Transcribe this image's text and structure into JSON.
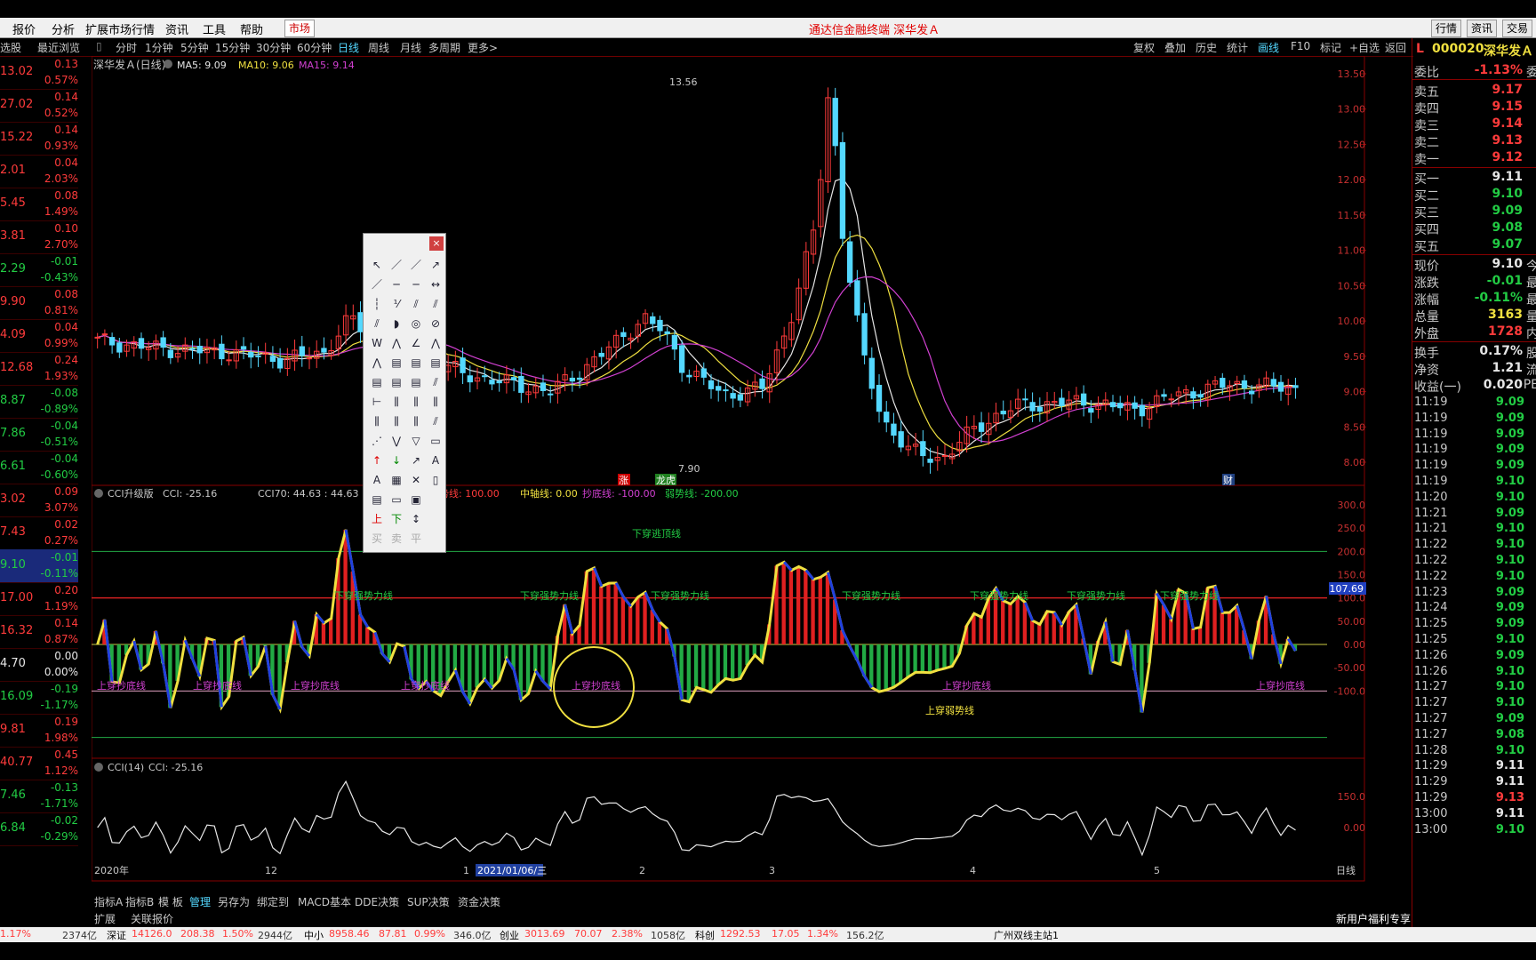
{
  "window_title": "通达信金融终端 深华发Ａ",
  "menu": [
    "报价",
    "分析",
    "扩展市场行情",
    "资讯",
    "工具",
    "帮助"
  ],
  "market_button": "市场",
  "right_buttons": [
    "行情",
    "资讯",
    "交易"
  ],
  "left_header": [
    "选股",
    "最近浏览"
  ],
  "periods": [
    "分时",
    "1分钟",
    "5分钟",
    "15分钟",
    "30分钟",
    "60分钟",
    "日线",
    "周线",
    "月线",
    "多周期",
    "更多>"
  ],
  "active_period": "日线",
  "chart_tools": [
    "复权",
    "叠加",
    "历史",
    "统计",
    "画线",
    "F10",
    "标记",
    "+自选",
    "返回"
  ],
  "stock_code": "000020",
  "stock_name": "深华发Ａ",
  "ma_legend": {
    "name": "深华发Ａ(日线)",
    "ma5": "MA5: 9.09",
    "ma10": "MA10: 9.06",
    "ma15": "MA15: 9.14"
  },
  "cci_header": {
    "name": "CCI升级版",
    "cci": "CCI: -25.16",
    "cci70": "CCI70: 44.63 : 44.63",
    "strong": "强势线: 100.00",
    "mid": "中轴线: 0.00",
    "bottom": "抄底线: -100.00",
    "weak": "弱势线: -200.00"
  },
  "cci14_header": {
    "name": "CCI(14)",
    "cci": "CCI: -25.16"
  },
  "left_list": [
    {
      "price": "13.02",
      "change": "0.13",
      "pct": "0.57%",
      "up": true
    },
    {
      "price": "27.02",
      "change": "0.14",
      "pct": "0.52%",
      "up": true
    },
    {
      "price": "15.22",
      "change": "0.14",
      "pct": "0.93%",
      "up": true
    },
    {
      "price": "2.01",
      "change": "0.04",
      "pct": "2.03%",
      "up": true
    },
    {
      "price": "5.45",
      "change": "0.08",
      "pct": "1.49%",
      "up": true
    },
    {
      "price": "3.81",
      "change": "0.10",
      "pct": "2.70%",
      "up": true
    },
    {
      "price": "2.29",
      "change": "-0.01",
      "pct": "-0.43%",
      "up": false
    },
    {
      "price": "9.90",
      "change": "0.08",
      "pct": "0.81%",
      "up": true
    },
    {
      "price": "4.09",
      "change": "0.04",
      "pct": "0.99%",
      "up": true
    },
    {
      "price": "12.68",
      "change": "0.24",
      "pct": "1.93%",
      "up": true
    },
    {
      "price": "8.87",
      "change": "-0.08",
      "pct": "-0.89%",
      "up": false
    },
    {
      "price": "7.86",
      "change": "-0.04",
      "pct": "-0.51%",
      "up": false
    },
    {
      "price": "6.61",
      "change": "-0.04",
      "pct": "-0.60%",
      "up": false
    },
    {
      "price": "3.02",
      "change": "0.09",
      "pct": "3.07%",
      "up": true
    },
    {
      "price": "7.43",
      "change": "0.02",
      "pct": "0.27%",
      "up": true
    },
    {
      "price": "9.10",
      "change": "-0.01",
      "pct": "-0.11%",
      "up": false
    },
    {
      "price": "17.00",
      "change": "0.20",
      "pct": "1.19%",
      "up": true
    },
    {
      "price": "16.32",
      "change": "0.14",
      "pct": "0.87%",
      "up": true
    },
    {
      "price": "4.70",
      "change": "0.00",
      "pct": "0.00%",
      "up": null
    },
    {
      "price": "16.09",
      "change": "-0.19",
      "pct": "-1.17%",
      "up": false
    },
    {
      "price": "9.81",
      "change": "0.19",
      "pct": "1.98%",
      "up": true
    },
    {
      "price": "40.77",
      "change": "0.45",
      "pct": "1.12%",
      "up": true
    },
    {
      "price": "7.46",
      "change": "-0.13",
      "pct": "-1.71%",
      "up": false
    },
    {
      "price": "6.84",
      "change": "-0.02",
      "pct": "-0.29%",
      "up": false
    }
  ],
  "price_axis": [
    "13.50",
    "13.00",
    "12.50",
    "12.00",
    "11.50",
    "11.00",
    "10.50",
    "10.00",
    "9.50",
    "9.00",
    "8.50",
    "8.00"
  ],
  "cci_axis": [
    "300.0",
    "250.0",
    "200.0",
    "150.0",
    "100.0",
    "50.00",
    "0.00",
    "-50.00",
    "-100.0"
  ],
  "cci_marker": "107.69",
  "cci14_axis": [
    "150.0",
    "0.00"
  ],
  "chart_labels": {
    "high": "13.56",
    "low": "7.90",
    "zhang": "涨",
    "longhu": "龙虎",
    "cai": "财"
  },
  "cci_annotations": {
    "strong_cross": [
      "下穿强势力线",
      "下穿强势力线",
      "下穿强势力线",
      "下穿强势力线",
      "下穿强势力线",
      "下穿强势力线",
      "下穿强势力线"
    ],
    "escape": "下穿逃顶线",
    "bottom_cross": [
      "上穿抄底线",
      "上穿抄底线",
      "上穿抄底线",
      "上穿抄底线",
      "上穿抄底线",
      "上穿抄底线",
      "上穿抄底线"
    ],
    "weak_cross": "上穿弱势线"
  },
  "date_axis": {
    "year": "2020年",
    "m12": "12",
    "m1": "1",
    "selected": "2021/01/06/三",
    "m2": "2",
    "m3": "3",
    "m4": "4",
    "m5": "5",
    "period": "日线"
  },
  "bottom_tabs": [
    "指标A",
    "指标B",
    "模 板",
    "管理",
    "另存为",
    "绑定到",
    "MACD基本",
    "DDE决策",
    "SUP决策",
    "资金决策"
  ],
  "bottom_tabs2": [
    "扩展",
    "关联报价"
  ],
  "quote_panel": {
    "weibi": {
      "label": "委比",
      "value": "-1.13%",
      "extra": "委"
    },
    "sell": [
      {
        "label": "卖五",
        "price": "9.17"
      },
      {
        "label": "卖四",
        "price": "9.15"
      },
      {
        "label": "卖三",
        "price": "9.14"
      },
      {
        "label": "卖二",
        "price": "9.13"
      },
      {
        "label": "卖一",
        "price": "9.12"
      }
    ],
    "buy": [
      {
        "label": "买一",
        "price": "9.11"
      },
      {
        "label": "买二",
        "price": "9.10"
      },
      {
        "label": "买三",
        "price": "9.09"
      },
      {
        "label": "买四",
        "price": "9.08"
      },
      {
        "label": "买五",
        "price": "9.07"
      }
    ],
    "stats": [
      {
        "label": "现价",
        "value": "9.10",
        "extra": "今"
      },
      {
        "label": "涨跌",
        "value": "-0.01",
        "extra": "最"
      },
      {
        "label": "涨幅",
        "value": "-0.11%",
        "extra": "最"
      },
      {
        "label": "总量",
        "value": "3163",
        "extra": "量"
      },
      {
        "label": "外盘",
        "value": "1728",
        "extra": "内"
      }
    ],
    "stats2": [
      {
        "label": "换手",
        "value": "0.17%",
        "extra": "股"
      },
      {
        "label": "净资",
        "value": "1.21",
        "extra": "流"
      },
      {
        "label": "收益(一)",
        "value": "0.020",
        "extra": "PE"
      }
    ]
  },
  "ticks": [
    {
      "t": "11:19",
      "p": "9.09"
    },
    {
      "t": "11:19",
      "p": "9.09"
    },
    {
      "t": "11:19",
      "p": "9.09"
    },
    {
      "t": "11:19",
      "p": "9.09"
    },
    {
      "t": "11:19",
      "p": "9.09"
    },
    {
      "t": "11:19",
      "p": "9.10"
    },
    {
      "t": "11:20",
      "p": "9.10"
    },
    {
      "t": "11:21",
      "p": "9.09"
    },
    {
      "t": "11:21",
      "p": "9.10"
    },
    {
      "t": "11:22",
      "p": "9.10"
    },
    {
      "t": "11:22",
      "p": "9.10"
    },
    {
      "t": "11:22",
      "p": "9.10"
    },
    {
      "t": "11:23",
      "p": "9.09"
    },
    {
      "t": "11:24",
      "p": "9.09"
    },
    {
      "t": "11:25",
      "p": "9.09"
    },
    {
      "t": "11:25",
      "p": "9.10"
    },
    {
      "t": "11:26",
      "p": "9.09"
    },
    {
      "t": "11:26",
      "p": "9.10"
    },
    {
      "t": "11:27",
      "p": "9.10"
    },
    {
      "t": "11:27",
      "p": "9.10"
    },
    {
      "t": "11:27",
      "p": "9.09"
    },
    {
      "t": "11:27",
      "p": "9.08"
    },
    {
      "t": "11:28",
      "p": "9.10"
    },
    {
      "t": "11:29",
      "p": "9.11"
    },
    {
      "t": "11:29",
      "p": "9.11"
    },
    {
      "t": "11:29",
      "p": "9.13"
    },
    {
      "t": "13:00",
      "p": "9.11"
    },
    {
      "t": "13:00",
      "p": "9.10"
    }
  ],
  "status_bar": {
    "item0": "1.17%",
    "item0b": "2374亿",
    "shen_label": "深证",
    "shen": "14126.0",
    "shen_chg": "208.38",
    "shen_pct": "1.50%",
    "shen_amt": "2944亿",
    "zx_label": "中小",
    "zx": "8958.46",
    "zx_chg": "87.81",
    "zx_pct": "0.99%",
    "zx_amt": "346.0亿",
    "cy_label": "创业",
    "cy": "3013.69",
    "cy_chg": "70.07",
    "cy_pct": "2.38%",
    "cy_amt": "1058亿",
    "kc_label": "科创",
    "kc": "1292.53",
    "kc_chg": "17.05",
    "kc_pct": "1.34%",
    "kc_amt": "156.2亿",
    "server": "广州双线主站1",
    "promo": "新用户福利专享"
  },
  "colors": {
    "up": "#ff3b3b",
    "down": "#22cc44",
    "cyan": "#54d8ff",
    "ma5": "#e6e6e6",
    "ma10": "#f0e040",
    "ma15": "#d040d0",
    "cci": "#f0e040",
    "cci_down": "#2040e0"
  }
}
